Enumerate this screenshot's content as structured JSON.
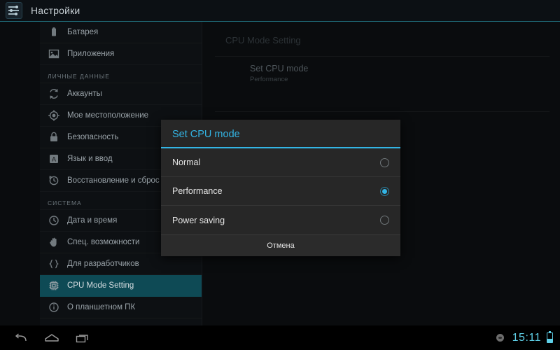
{
  "window": {
    "title": "Настройки",
    "app_icon": "settings-sliders-icon"
  },
  "theme": {
    "accent": "#33b5e5",
    "selected_row": "#0e4a55",
    "clock_color": "#5fd0e8",
    "dialog_bg": "#272727"
  },
  "sidebar": {
    "items": [
      {
        "type": "item",
        "label": "Батарея",
        "icon": "battery-icon",
        "selected": false
      },
      {
        "type": "item",
        "label": "Приложения",
        "icon": "apps-icon",
        "selected": false
      },
      {
        "type": "header",
        "label": "ЛИЧНЫЕ ДАННЫЕ"
      },
      {
        "type": "item",
        "label": "Аккаунты",
        "icon": "sync-icon",
        "selected": false
      },
      {
        "type": "item",
        "label": "Мое местоположение",
        "icon": "location-icon",
        "selected": false
      },
      {
        "type": "item",
        "label": "Безопасность",
        "icon": "lock-icon",
        "selected": false
      },
      {
        "type": "item",
        "label": "Язык и ввод",
        "icon": "language-icon",
        "selected": false
      },
      {
        "type": "item",
        "label": "Восстановление и сброс",
        "icon": "restore-icon",
        "selected": false
      },
      {
        "type": "header",
        "label": "СИСТЕМА"
      },
      {
        "type": "item",
        "label": "Дата и время",
        "icon": "clock-icon",
        "selected": false
      },
      {
        "type": "item",
        "label": "Спец. возможности",
        "icon": "hand-icon",
        "selected": false
      },
      {
        "type": "item",
        "label": "Для разработчиков",
        "icon": "braces-icon",
        "selected": false
      },
      {
        "type": "item",
        "label": "CPU Mode Setting",
        "icon": "cpu-chip-icon",
        "selected": true
      },
      {
        "type": "item",
        "label": "О планшетном ПК",
        "icon": "info-icon",
        "selected": false
      }
    ]
  },
  "pane": {
    "title": "CPU Mode Setting",
    "row_title": "Set CPU mode",
    "row_subtitle": "Performance"
  },
  "dialog": {
    "title": "Set CPU mode",
    "options": [
      {
        "label": "Normal",
        "selected": false
      },
      {
        "label": "Performance",
        "selected": true
      },
      {
        "label": "Power saving",
        "selected": false
      }
    ],
    "cancel_label": "Отмена"
  },
  "systembar": {
    "back_icon": "back-arrow-icon",
    "home_icon": "home-icon",
    "recents_icon": "recent-apps-icon",
    "status_dot_icon": "usb-debug-icon",
    "clock": "15:11",
    "battery_icon": "battery-icon",
    "battery_level_percent": 42
  }
}
